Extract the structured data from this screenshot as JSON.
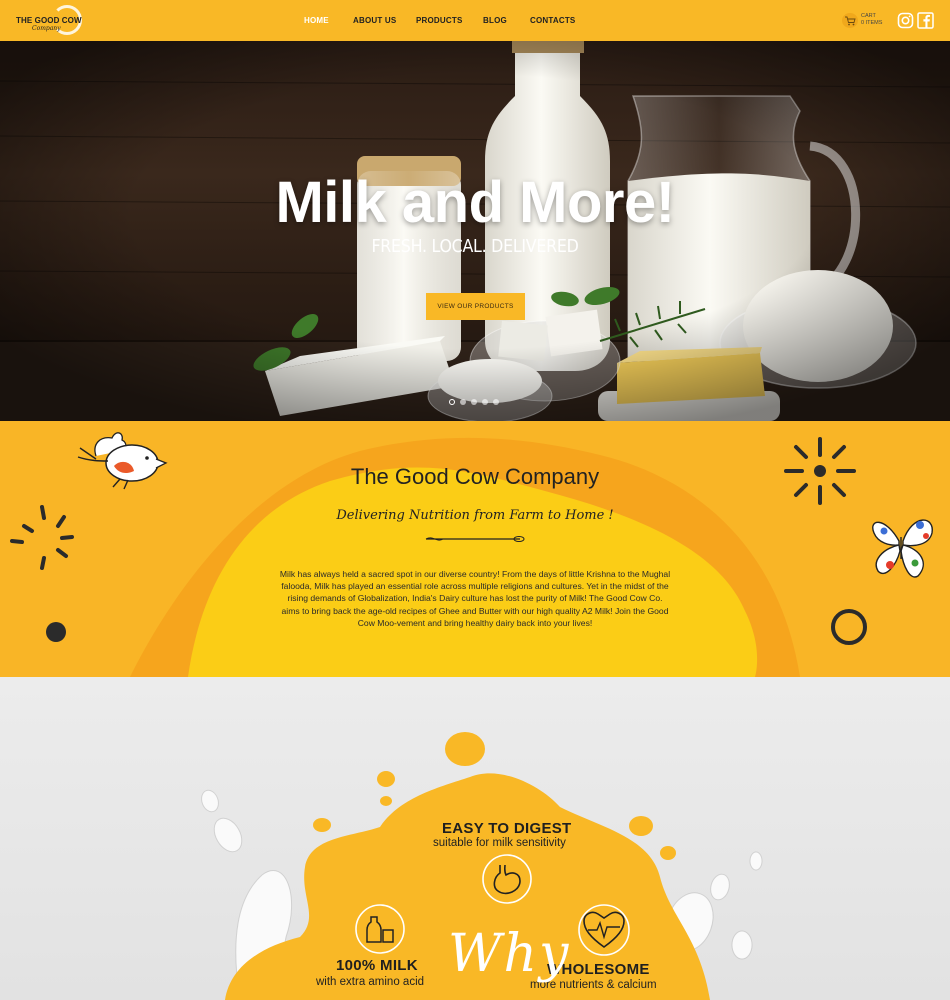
{
  "header": {
    "logo_title": "THE GOOD COW",
    "logo_sub": "Company",
    "nav": [
      "HOME",
      "ABOUT US",
      "PRODUCTS",
      "BLOG",
      "CONTACTS"
    ],
    "active_nav": "HOME",
    "cart_label": "CART",
    "cart_count": "0 ITEMS",
    "social": [
      "instagram-icon",
      "facebook-icon"
    ]
  },
  "hero": {
    "title": "Milk and More!",
    "subtitle": "FRESH. LOCAL. DELIVERED",
    "button": "VIEW OUR PRODUCTS",
    "slides": 5,
    "active_slide": 1
  },
  "about": {
    "title": "The Good Cow Company",
    "tagline": "Delivering Nutrition from Farm to Home !",
    "body": "Milk has always held a sacred spot in our diverse country! From the days of little Krishna to the Mughal falooda, Milk has played an essential role across multiple religions and cultures. Yet in the midst of the rising demands of Globalization, India's Dairy culture has lost the purity of Milk! The Good Cow Co. aims to bring back the age-old recipes of Ghee and Butter with our high quality A2 Milk! Join the Good Cow Moo-vement and bring healthy dairy back into your lives!"
  },
  "why": {
    "script": "Why",
    "features": [
      {
        "title": "EASY TO DIGEST",
        "sub": "suitable for milk sensitivity",
        "icon": "stomach-icon"
      },
      {
        "title": "100% MILK",
        "sub": "with extra amino acid",
        "icon": "milk-bottle-icon"
      },
      {
        "title": "WHOLESOME",
        "sub": "more nutrients & calcium",
        "icon": "heart-pulse-icon"
      }
    ]
  },
  "colors": {
    "brand": "#f9b826",
    "dark": "#222222",
    "white": "#ffffff"
  }
}
